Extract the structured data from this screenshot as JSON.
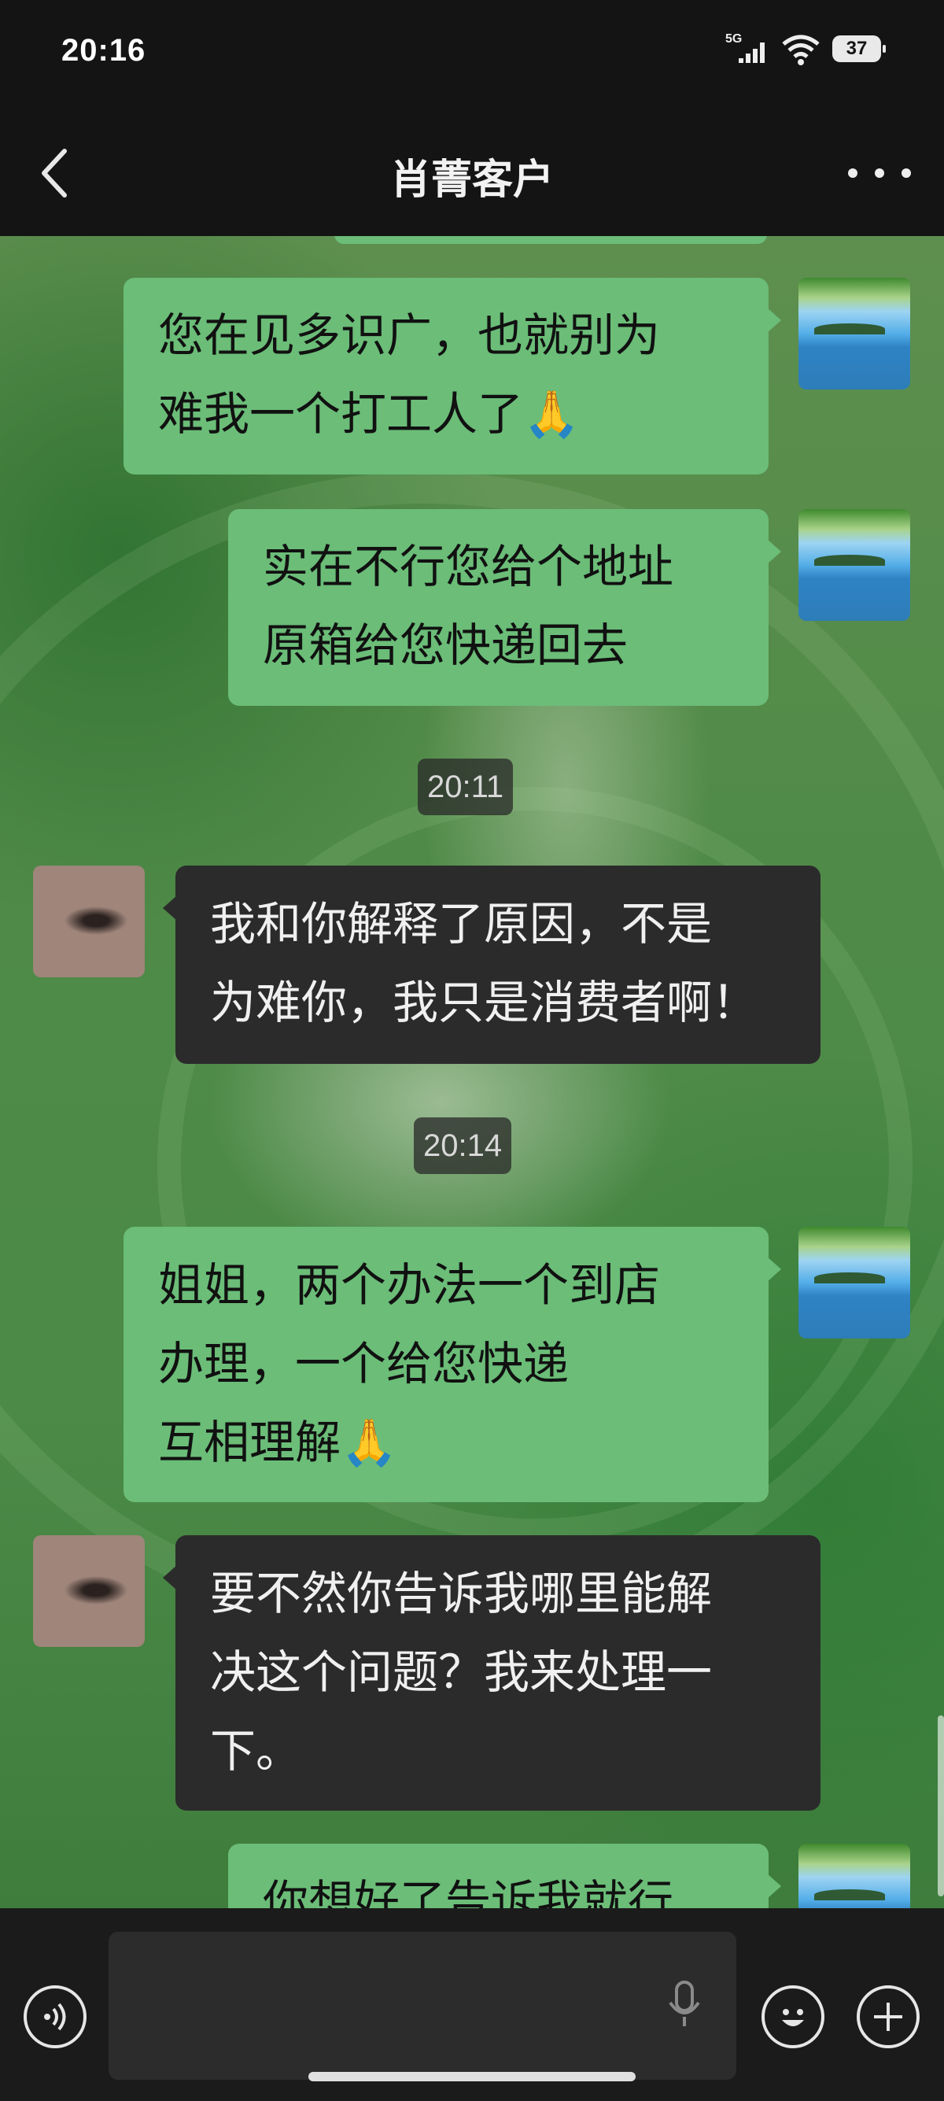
{
  "status_bar": {
    "time": "20:16",
    "network": "5G",
    "battery": "37"
  },
  "header": {
    "title": "肖菁客户",
    "back_icon": "chevron-left-icon",
    "more_icon": "more-dots-icon"
  },
  "messages": [
    {
      "sender": "me",
      "text": "您在见多识广，也就别为\n难我一个打工人了🙏"
    },
    {
      "sender": "me",
      "text": "实在不行您给个地址\n原箱给您快递回去"
    },
    {
      "type": "timestamp",
      "text": "20:11"
    },
    {
      "sender": "other",
      "text": "我和你解释了原因，不是\n为难你，我只是消费者啊！"
    },
    {
      "type": "timestamp",
      "text": "20:14"
    },
    {
      "sender": "me",
      "text": "姐姐，两个办法一个到店\n办理，一个给您快递\n互相理解🙏"
    },
    {
      "sender": "other",
      "text": "要不然你告诉我哪里能解\n决这个问题？我来处理一\n下。"
    },
    {
      "sender": "me",
      "text": "你想好了告诉我就行"
    }
  ],
  "input_bar": {
    "voice_icon": "voice-icon",
    "mic_icon": "microphone-icon",
    "emoji_icon": "emoji-icon",
    "plus_icon": "plus-icon",
    "message_value": ""
  },
  "colors": {
    "my_bubble": "#6bbd78",
    "other_bubble": "#2b2b2b",
    "bar_bg": "#141414"
  }
}
